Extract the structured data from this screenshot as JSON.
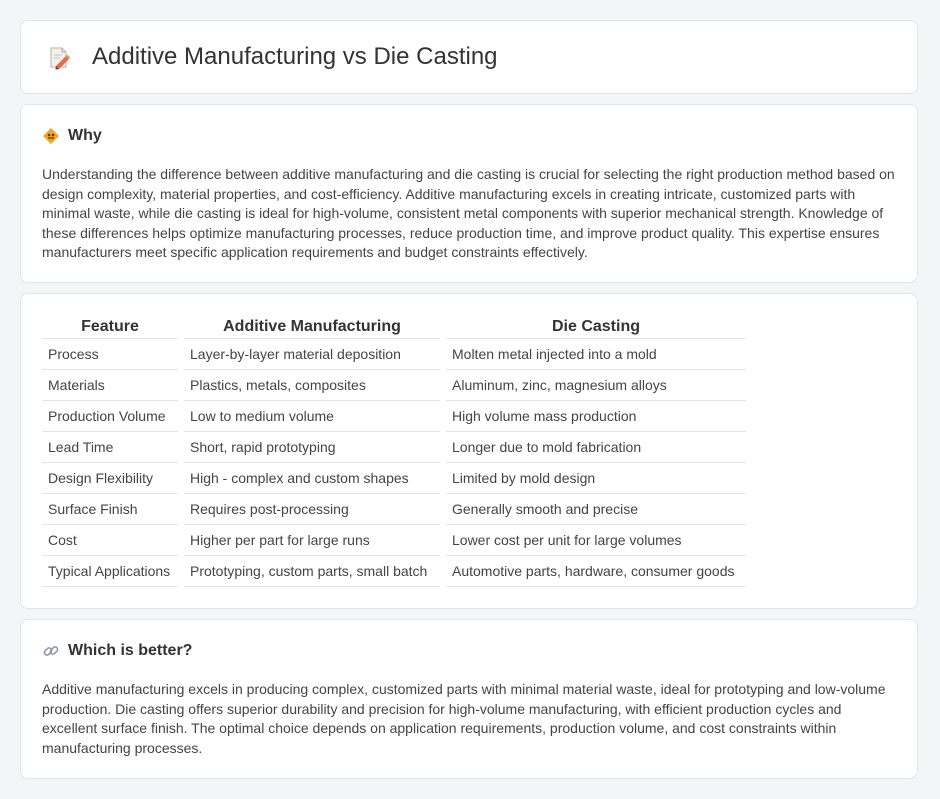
{
  "header": {
    "title": "Additive Manufacturing vs Die Casting",
    "icon": "document-pencil-icon"
  },
  "why": {
    "heading": "Why",
    "icon": "diamond-sign-icon",
    "body": "Understanding the difference between additive manufacturing and die casting is crucial for selecting the right production method based on design complexity, material properties, and cost-efficiency. Additive manufacturing excels in creating intricate, customized parts with minimal waste, while die casting is ideal for high-volume, consistent metal components with superior mechanical strength. Knowledge of these differences helps optimize manufacturing processes, reduce production time, and improve product quality. This expertise ensures manufacturers meet specific application requirements and budget constraints effectively."
  },
  "comparison": {
    "headers": [
      "Feature",
      "Additive Manufacturing",
      "Die Casting"
    ],
    "rows": [
      [
        "Process",
        "Layer-by-layer material deposition",
        "Molten metal injected into a mold"
      ],
      [
        "Materials",
        "Plastics, metals, composites",
        "Aluminum, zinc, magnesium alloys"
      ],
      [
        "Production Volume",
        "Low to medium volume",
        "High volume mass production"
      ],
      [
        "Lead Time",
        "Short, rapid prototyping",
        "Longer due to mold fabrication"
      ],
      [
        "Design Flexibility",
        "High - complex and custom shapes",
        "Limited by mold design"
      ],
      [
        "Surface Finish",
        "Requires post-processing",
        "Generally smooth and precise"
      ],
      [
        "Cost",
        "Higher per part for large runs",
        "Lower cost per unit for large volumes"
      ],
      [
        "Typical Applications",
        "Prototyping, custom parts, small batch",
        "Automotive parts, hardware, consumer goods"
      ]
    ]
  },
  "better": {
    "heading": "Which is better?",
    "icon": "link-icon",
    "body": "Additive manufacturing excels in producing complex, customized parts with minimal material waste, ideal for prototyping and low-volume production. Die casting offers superior durability and precision for high-volume manufacturing, with efficient production cycles and excellent surface finish. The optimal choice depends on application requirements, production volume, and cost constraints within manufacturing processes."
  }
}
